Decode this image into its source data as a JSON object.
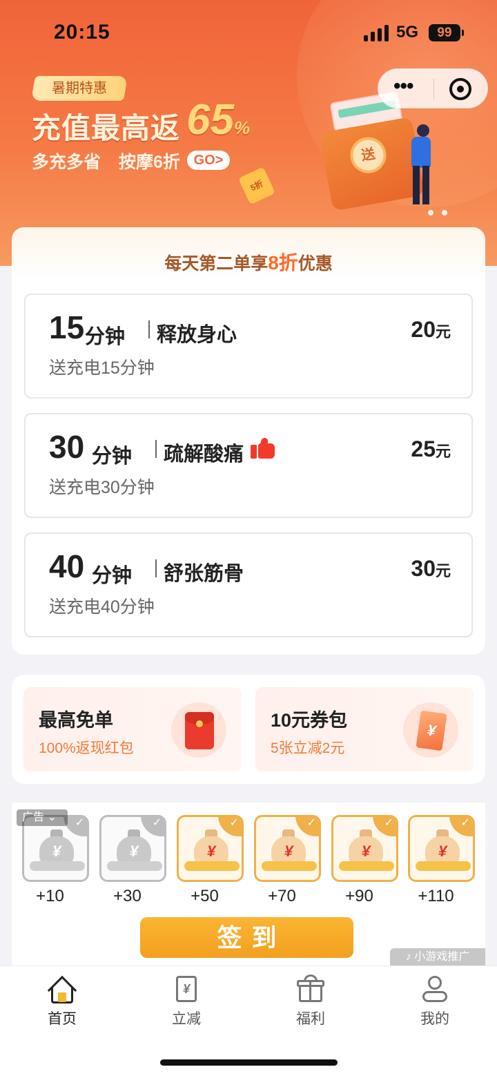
{
  "status_bar": {
    "time": "20:15",
    "network": "5G",
    "battery": "99"
  },
  "banner": {
    "tag": "暑期特惠",
    "title": "充值最高返",
    "percent": "65",
    "percent_sign": "%",
    "sub_left": "多充多省",
    "sub_right": "按摩6折",
    "go_label": "GO>",
    "ticket_text": "5折",
    "coin_text": "送"
  },
  "capsule": {
    "more_icon": "more-dots-icon",
    "close_icon": "target-close-icon"
  },
  "main": {
    "daily_offer_prefix": "每天第二单享",
    "daily_offer_highlight": "8折",
    "daily_offer_suffix": "优惠",
    "packages": [
      {
        "minutes": "15",
        "unit": "分钟",
        "name": "释放身心",
        "price": "20",
        "currency": "元",
        "bonus": "送充电15分钟",
        "hot": false
      },
      {
        "minutes": "30",
        "unit": "分钟",
        "name": "疏解酸痛",
        "price": "25",
        "currency": "元",
        "bonus": "送充电30分钟",
        "hot": true
      },
      {
        "minutes": "40",
        "unit": "分钟",
        "name": "舒张筋骨",
        "price": "30",
        "currency": "元",
        "bonus": "送充电40分钟",
        "hot": false
      }
    ]
  },
  "welfare": [
    {
      "title": "最高免单",
      "subtitle": "100%返现红包",
      "icon": "red-packet-icon"
    },
    {
      "title": "10元券包",
      "subtitle": "5张立减2元",
      "icon": "coupon-icon",
      "icon_text": "¥"
    }
  ],
  "signin": {
    "ad_badge": "广告 ⌄",
    "days": [
      {
        "label": "+10",
        "tier": "silver",
        "symbol": "¥",
        "check": "✓"
      },
      {
        "label": "+30",
        "tier": "silver",
        "symbol": "¥",
        "check": "✓"
      },
      {
        "label": "+50",
        "tier": "gold",
        "symbol": "¥",
        "check": "✓"
      },
      {
        "label": "+70",
        "tier": "gold",
        "symbol": "¥",
        "check": "✓"
      },
      {
        "label": "+90",
        "tier": "gold",
        "symbol": "¥",
        "check": "✓"
      },
      {
        "label": "+110",
        "tier": "gold",
        "symbol": "¥",
        "check": "✓"
      }
    ],
    "button_label": "签到",
    "ad_tag": "♪ 小游戏推广"
  },
  "tabbar": {
    "tabs": [
      {
        "label": "首页",
        "icon": "home-icon",
        "active": true
      },
      {
        "label": "立减",
        "icon": "discount-doc-icon",
        "icon_text": "¥",
        "active": false
      },
      {
        "label": "福利",
        "icon": "gift-icon",
        "active": false
      },
      {
        "label": "我的",
        "icon": "profile-icon",
        "active": false
      }
    ]
  },
  "colors": {
    "brand": "#f26a3b",
    "accent_gold": "#f3a020",
    "hot_red": "#f23a2a"
  }
}
